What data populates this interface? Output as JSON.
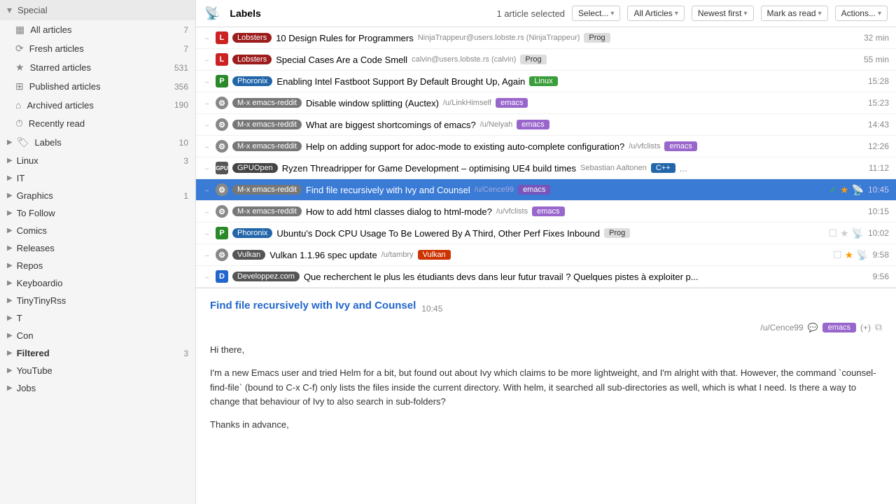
{
  "sidebar": {
    "special_label": "Special",
    "items": [
      {
        "id": "all-articles",
        "icon": "▦",
        "label": "All articles",
        "count": "7"
      },
      {
        "id": "fresh-articles",
        "icon": "⟳",
        "label": "Fresh articles",
        "count": "7"
      },
      {
        "id": "starred-articles",
        "icon": "★",
        "label": "Starred articles",
        "count": "531"
      },
      {
        "id": "published-articles",
        "icon": "⊞",
        "label": "Published articles",
        "count": "356"
      },
      {
        "id": "archived-articles",
        "icon": "⌂",
        "label": "Archived articles",
        "count": "190"
      },
      {
        "id": "recently-read",
        "icon": "⏱",
        "label": "Recently read",
        "count": ""
      }
    ],
    "labels_label": "Labels",
    "labels_count": "10",
    "groups": [
      {
        "id": "linux",
        "label": "Linux",
        "count": "3"
      },
      {
        "id": "it",
        "label": "IT",
        "count": ""
      },
      {
        "id": "graphics",
        "label": "Graphics",
        "count": "1"
      },
      {
        "id": "to-follow",
        "label": "To Follow",
        "count": ""
      },
      {
        "id": "comics",
        "label": "Comics",
        "count": ""
      },
      {
        "id": "releases",
        "label": "Releases",
        "count": ""
      },
      {
        "id": "repos",
        "label": "Repos",
        "count": ""
      },
      {
        "id": "keyboardio",
        "label": "Keyboardio",
        "count": ""
      },
      {
        "id": "tinytinyrss",
        "label": "TinyTinyRss",
        "count": ""
      },
      {
        "id": "t",
        "label": "T",
        "count": ""
      },
      {
        "id": "con",
        "label": "Con",
        "count": ""
      },
      {
        "id": "filtered",
        "label": "Filtered",
        "count": "3",
        "bold": true
      },
      {
        "id": "youtube",
        "label": "YouTube",
        "count": ""
      },
      {
        "id": "jobs",
        "label": "Jobs",
        "count": ""
      }
    ]
  },
  "header": {
    "logo": "📡",
    "title": "Labels",
    "selected_info": "1 article selected",
    "select_btn": "Select...",
    "all_articles_btn": "All Articles",
    "newest_first_btn": "Newest first",
    "mark_as_read_btn": "Mark as read",
    "actions_btn": "Actions..."
  },
  "articles": [
    {
      "id": "a1",
      "feed": "Lobsters",
      "feed_class": "lobsters",
      "source_letter": "L",
      "source_color": "red",
      "title": "10 Design Rules for Programmers",
      "author": "NinjaTrappeur@users.lobste.rs (NinjaTrappeur)",
      "tag": "Prog",
      "tag_class": "prog",
      "time": "32 min",
      "selected": false
    },
    {
      "id": "a2",
      "feed": "Lobsters",
      "feed_class": "lobsters",
      "source_letter": "L",
      "source_color": "red",
      "title": "Special Cases Are a Code Smell",
      "author": "calvin@users.lobste.rs (calvin)",
      "tag": "Prog",
      "tag_class": "prog",
      "time": "55 min",
      "selected": false
    },
    {
      "id": "a3",
      "feed": "Phoronix",
      "feed_class": "phoronix",
      "source_letter": "P",
      "source_color": "green",
      "title": "Enabling Intel Fastboot Support By Default Brought Up, Again",
      "author": "",
      "tag": "Linux",
      "tag_class": "linux",
      "time": "15:28",
      "selected": false
    },
    {
      "id": "a4",
      "feed": "M-x emacs-reddit",
      "feed_class": "emacs-reddit",
      "source_letter": "⚙",
      "source_color": "avatar",
      "title": "Disable window splitting (Auctex)",
      "author": "/u/LinkHimself",
      "tag": "emacs",
      "tag_class": "emacs",
      "time": "15:23",
      "selected": false
    },
    {
      "id": "a5",
      "feed": "M-x emacs-reddit",
      "feed_class": "emacs-reddit",
      "source_letter": "⚙",
      "source_color": "avatar",
      "title": "What are biggest shortcomings of emacs?",
      "author": "/u/Nelyah",
      "tag": "emacs",
      "tag_class": "emacs",
      "time": "14:43",
      "selected": false
    },
    {
      "id": "a6",
      "feed": "M-x emacs-reddit",
      "feed_class": "emacs-reddit",
      "source_letter": "⚙",
      "source_color": "avatar",
      "title": "Help on adding support for adoc-mode to existing auto-complete configuration?",
      "author": "/u/vfclists",
      "tag": "emacs",
      "tag_class": "emacs",
      "time": "12:26",
      "selected": false
    },
    {
      "id": "a7",
      "feed": "GPUOpen",
      "feed_class": "gpuopen",
      "source_letter": "GPU",
      "source_color": "gpu",
      "title": "Ryzen Threadripper for Game Development – optimising UE4 build times",
      "author": "Sebastian Aaltonen",
      "tag": "C++",
      "tag_class": "cpp",
      "tag2": "...",
      "time": "11:12",
      "selected": false
    },
    {
      "id": "a8",
      "feed": "M-x emacs-reddit",
      "feed_class": "emacs-reddit",
      "source_letter": "⚙",
      "source_color": "avatar",
      "title": "Find file recursively with Ivy and Counsel",
      "author": "/u/Cence99",
      "tag": "emacs",
      "tag_class": "emacs-sel",
      "time": "10:45",
      "selected": true
    },
    {
      "id": "a9",
      "feed": "M-x emacs-reddit",
      "feed_class": "emacs-reddit",
      "source_letter": "⚙",
      "source_color": "avatar",
      "title": "How to add html classes dialog to html-mode?",
      "author": "/u/vfclists",
      "tag": "emacs",
      "tag_class": "emacs",
      "time": "10:15",
      "selected": false
    },
    {
      "id": "a10",
      "feed": "Phoronix",
      "feed_class": "phoronix",
      "source_letter": "P",
      "source_color": "green",
      "title": "Ubuntu's Dock CPU Usage To Be Lowered By A Third, Other Perf Fixes Inbound",
      "author": "",
      "tag": "Prog",
      "tag_class": "prog",
      "time": "10:02",
      "selected": false
    },
    {
      "id": "a11",
      "feed": "Vulkan",
      "feed_class": "vulkan",
      "source_letter": "⚙",
      "source_color": "avatar",
      "title": "Vulkan 1.1.96 spec update",
      "author": "/u/tambry",
      "tag": "Vulkan",
      "tag_class": "vulkan-tag",
      "time": "9:58",
      "selected": false
    },
    {
      "id": "a12",
      "feed": "Developpez.com",
      "feed_class": "developpez",
      "source_letter": "D",
      "source_color": "blue",
      "title": "Que recherchent le plus les étudiants devs dans leur futur travail ? Quelques pistes à exploiter p...",
      "author": "",
      "tag": "",
      "tag_class": "",
      "time": "9:56",
      "selected": false
    }
  ],
  "detail": {
    "title": "Find file recursively with Ivy and Counsel",
    "time": "10:45",
    "author": "/u/Cence99",
    "tag": "emacs",
    "plus": "(+)",
    "body_p1": "Hi there,",
    "body_p2": "I'm a new Emacs user and tried Helm for a bit, but found out about Ivy which claims to be more lightweight, and I'm alright with that. However, the command `counsel-find-file` (bound to C-x C-f) only lists the files inside the current directory. With helm, it searched all sub-directories as well, which is what I need. Is there a way to change that behaviour of Ivy to also search in sub-folders?",
    "body_p3": "Thanks in advance,"
  }
}
